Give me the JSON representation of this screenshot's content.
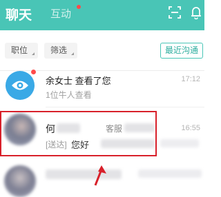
{
  "header": {
    "tab_chat": "聊天",
    "tab_interact": "互动",
    "scan_icon": "scan-icon",
    "bell_icon": "bell-icon"
  },
  "filters": {
    "position_label": "职位",
    "filter_label": "筛选",
    "recent_label": "最近沟通"
  },
  "items": [
    {
      "title": "余女士 查看了您",
      "subtitle": "1位牛人查看",
      "time": "17:12",
      "icon": "eye-icon",
      "unread": true
    },
    {
      "name": "何",
      "service": "客服",
      "tag": "[送达]",
      "message": "您好",
      "time": "16:55"
    }
  ],
  "colors": {
    "accent": "#49c5b6",
    "highlight_box": "#d8202a",
    "unread_dot": "#ff4a4a"
  }
}
